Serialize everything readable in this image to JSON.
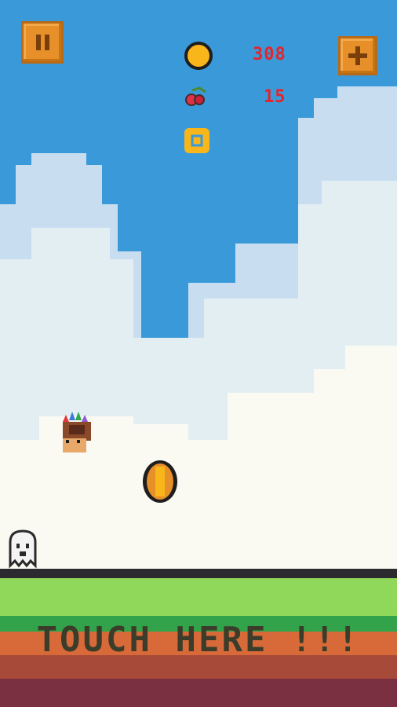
{
  "hud": {
    "coin_count": "308",
    "cherry_count": "15",
    "pause_icon": "pause-icon",
    "add_icon": "plus-icon"
  },
  "ground": {
    "touch_label": "TOUCH HERE !!!"
  },
  "colors": {
    "sky": "#3a9ad9",
    "cloud": "#e8f2f4",
    "grass": "#8fd85a",
    "grass_dark": "#32a34a",
    "dirt": "#d86a3a",
    "dirt_dark": "#8e3b3b",
    "text_red": "#e4242c"
  }
}
